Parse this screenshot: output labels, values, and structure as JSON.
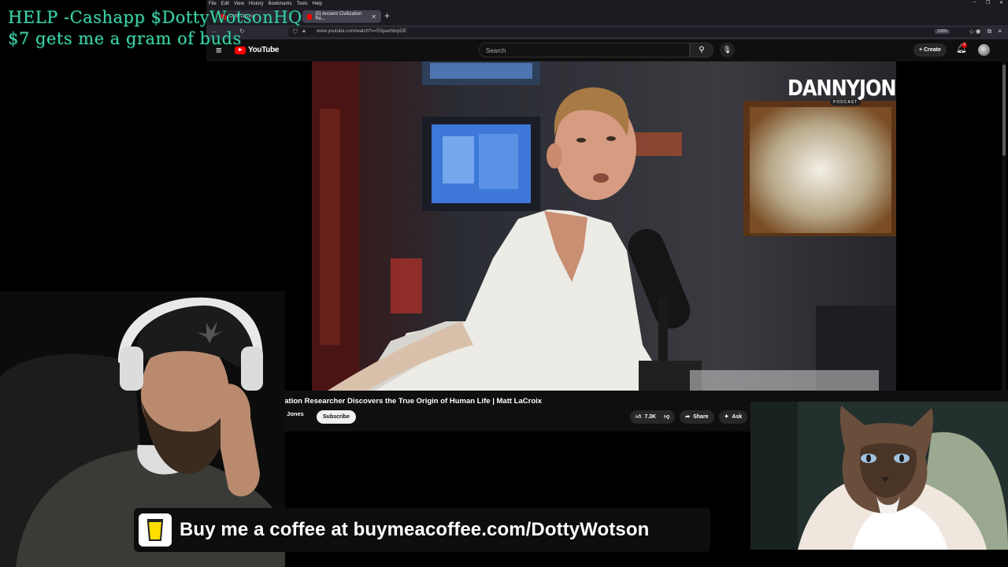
{
  "browser": {
    "menu": [
      "File",
      "Edit",
      "View",
      "History",
      "Bookmarks",
      "Tools",
      "Help"
    ],
    "tabs": [
      {
        "label": "DottyWotson"
      },
      {
        "label": "(5) Ancient Civilization Re..."
      }
    ],
    "url": "www.youtube.com/watch?v=SSpaxhbrpOE",
    "zoom": "150%"
  },
  "youtube": {
    "logo_text": "YouTube",
    "search_placeholder": "Search",
    "create_label": "Create",
    "notification_count": "9"
  },
  "video": {
    "brand": "DANNYJONES",
    "brand_sub": "PODCAST",
    "title": "t Civilization Researcher Discovers the True Origin of Human Life | Matt LaCroix",
    "channel": "of Danny Jones",
    "subscribe_label": "Subscribe",
    "likes": "7.3K",
    "share_label": "Share",
    "ask_label": "Ask"
  },
  "overlay": {
    "help_line1": "HELP -Cashapp $DottyWotsonHQ",
    "help_line2": "$7 gets me a gram of buds",
    "coffee_text": "Buy me a coffee at buymeacoffee.com/DottyWotson"
  },
  "colors": {
    "help_text": "#3dd2a7",
    "youtube_red": "#ff0000",
    "page_bg": "#0f0f0f"
  }
}
